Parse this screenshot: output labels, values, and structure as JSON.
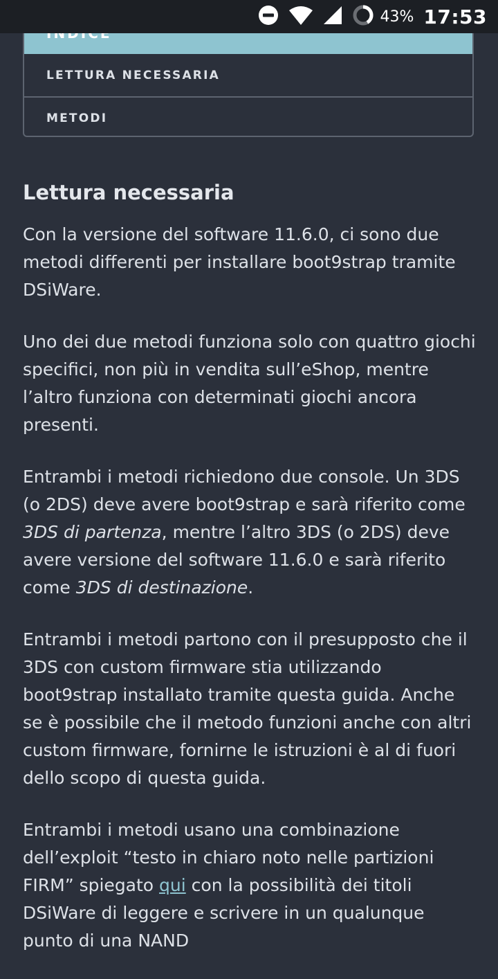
{
  "status_bar": {
    "battery_percent": "43%",
    "time": "17:53",
    "icons": [
      "do-not-disturb-icon",
      "wifi-icon",
      "signal-icon",
      "battery-icon"
    ]
  },
  "toc": {
    "header_label": "INDICE",
    "items": [
      "LETTURA NECESSARIA",
      "METODI"
    ]
  },
  "article": {
    "heading": "Lettura necessaria",
    "p1": "Con la versione del software 11.6.0, ci sono due metodi differenti per installare boot9strap tramite DSiWare.",
    "p2": "Uno dei due metodi funziona solo con quattro giochi specifici, non più in vendita sull’eShop, mentre l’altro funziona con determinati giochi ancora presenti.",
    "p3": {
      "a": "Entrambi i metodi richiedono due console. Un 3DS (o 2DS) deve avere boot9strap e sarà riferito come ",
      "b": "3DS di partenza",
      "c": ", mentre l’altro 3DS (o 2DS) deve avere versione del software 11.6.0 e sarà riferito come ",
      "d": "3DS di destinazione",
      "e": "."
    },
    "p4": "Entrambi i metodi partono con il presupposto che il 3DS con custom firmware stia utilizzando boot9strap installato tramite questa guida. Anche se è possibile che il metodo funzioni anche con altri custom firmware, fornirne le istruzioni è al di fuori dello scopo di questa guida.",
    "p5": {
      "a": "Entrambi i metodi usano una combinazione dell’exploit “testo in chiaro noto nelle partizioni FIRM” spiegato ",
      "link": "qui",
      "b": " con la possibilità dei titoli DSiWare di leggere e scrivere in un qualunque punto di una NAND"
    }
  }
}
